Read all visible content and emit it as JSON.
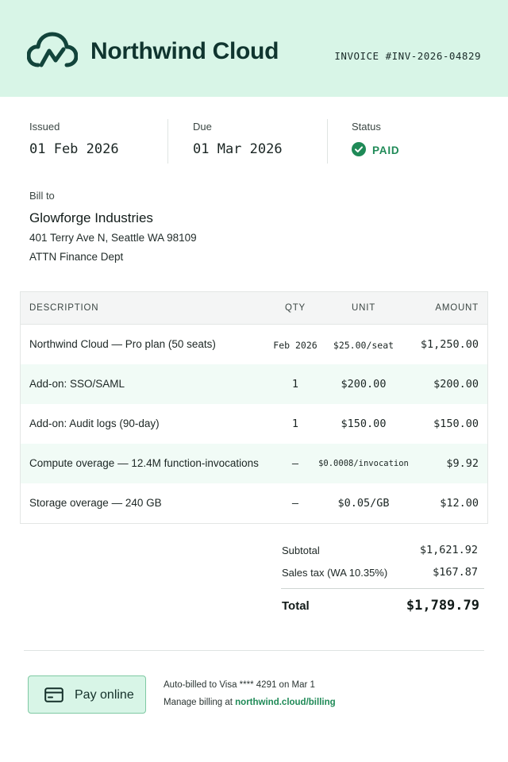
{
  "header": {
    "brand": "Northwind Cloud",
    "invoice_number": "INVOICE #INV-2026-04829",
    "logo_icon": "cloud-wave-icon",
    "background": "#d8f5e7"
  },
  "meta": {
    "issued_label": "Issued",
    "issued_value": "01 Feb 2026",
    "due_label": "Due",
    "due_value": "01 Mar 2026",
    "status_label": "Status",
    "status_value": "PAID",
    "status_icon": "check-circle-icon",
    "status_color": "#1f8a57"
  },
  "bill_to": {
    "label": "Bill to",
    "company": "Glowforge Industries",
    "address": "401 Terry Ave N, Seattle WA 98109",
    "attn": "ATTN Finance Dept"
  },
  "table": {
    "headers": {
      "description": "DESCRIPTION",
      "qty": "QTY",
      "unit": "UNIT",
      "amount": "AMOUNT"
    },
    "rows": [
      {
        "description": "Northwind Cloud — Pro plan (50 seats)",
        "qty": "Feb 2026",
        "unit": "$25.00/seat",
        "amount": "$1,250.00"
      },
      {
        "description": "Add-on: SSO/SAML",
        "qty": "1",
        "unit": "$200.00",
        "amount": "$200.00"
      },
      {
        "description": "Add-on: Audit logs (90-day)",
        "qty": "1",
        "unit": "$150.00",
        "amount": "$150.00"
      },
      {
        "description": "Compute overage — 12.4M function-invocations",
        "qty": "—",
        "unit": "$0.0008/invocation",
        "amount": "$9.92"
      },
      {
        "description": "Storage overage — 240 GB",
        "qty": "—",
        "unit": "$0.05/GB",
        "amount": "$12.00"
      }
    ]
  },
  "totals": {
    "subtotal_label": "Subtotal",
    "subtotal_value": "$1,621.92",
    "tax_label": "Sales tax (WA 10.35%)",
    "tax_value": "$167.87",
    "total_label": "Total",
    "total_value": "$1,789.79"
  },
  "footer": {
    "pay_button_label": "Pay online",
    "pay_icon": "credit-card-icon",
    "autobill_text": "Auto-billed to Visa **** 4291 on Mar 1",
    "manage_prefix": "Manage billing at",
    "manage_link": "northwind.cloud/billing",
    "accent": "#1f8a57"
  }
}
